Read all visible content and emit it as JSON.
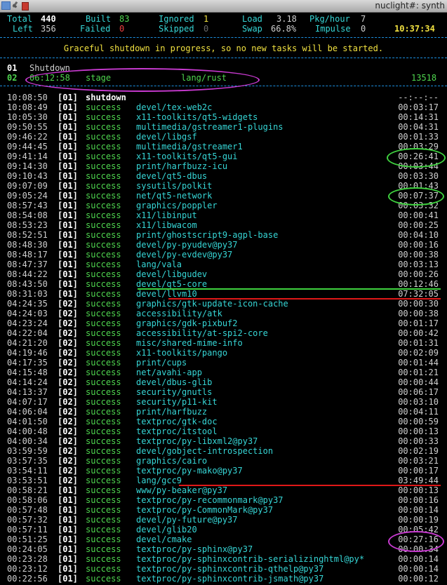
{
  "window": {
    "title": "nuclight#: synth"
  },
  "stats": {
    "row1": [
      {
        "label": "Total",
        "value": "440",
        "color": "white"
      },
      {
        "label": "Built",
        "value": "83",
        "color": "green"
      },
      {
        "label": "Ignored",
        "value": "1",
        "color": "yellow"
      },
      {
        "label": "Load",
        "value": "3.18",
        "color": "grey"
      },
      {
        "label": "Pkg/hour",
        "value": "7",
        "color": "grey"
      }
    ],
    "row2": [
      {
        "label": "Left",
        "value": "356",
        "color": "grey"
      },
      {
        "label": "Failed",
        "value": "0",
        "color": "red"
      },
      {
        "label": "Skipped",
        "value": "0",
        "color": "dimgrey"
      },
      {
        "label": "Swap",
        "value": "66.8%",
        "color": "grey"
      },
      {
        "label": "Impulse",
        "value": "0",
        "color": "grey"
      }
    ],
    "clock": "10:37:34"
  },
  "notice": "Graceful shutdown in progress, so no new tasks will be started.",
  "builders": [
    {
      "id": "01",
      "status": "Shutdown",
      "elapsed": "",
      "phase": "",
      "origin": "",
      "lines": ""
    },
    {
      "id": "02",
      "status": "",
      "elapsed": "06:12:58",
      "phase": "stage",
      "origin": "lang/rust",
      "lines": "13518"
    }
  ],
  "log": [
    {
      "time": "10:08:50",
      "slot": "[01]",
      "result": "shutdown",
      "origin": "",
      "duration": "--:--:--"
    },
    {
      "time": "10:08:49",
      "slot": "[01]",
      "result": "success",
      "origin": "devel/tex-web2c",
      "duration": "00:03:17"
    },
    {
      "time": "10:05:30",
      "slot": "[01]",
      "result": "success",
      "origin": "x11-toolkits/qt5-widgets",
      "duration": "00:14:31"
    },
    {
      "time": "09:50:55",
      "slot": "[01]",
      "result": "success",
      "origin": "multimedia/gstreamer1-plugins",
      "duration": "00:04:31"
    },
    {
      "time": "09:46:22",
      "slot": "[01]",
      "result": "success",
      "origin": "devel/libgsf",
      "duration": "00:01:33"
    },
    {
      "time": "09:44:45",
      "slot": "[01]",
      "result": "success",
      "origin": "multimedia/gstreamer1",
      "duration": "00:03:29"
    },
    {
      "time": "09:41:14",
      "slot": "[01]",
      "result": "success",
      "origin": "x11-toolkits/qt5-gui",
      "duration": "00:26:41"
    },
    {
      "time": "09:14:30",
      "slot": "[01]",
      "result": "success",
      "origin": "print/harfbuzz-icu",
      "duration": "00:03:44"
    },
    {
      "time": "09:10:43",
      "slot": "[01]",
      "result": "success",
      "origin": "devel/qt5-dbus",
      "duration": "00:03:30"
    },
    {
      "time": "09:07:09",
      "slot": "[01]",
      "result": "success",
      "origin": "sysutils/polkit",
      "duration": "00:01:43"
    },
    {
      "time": "09:05:24",
      "slot": "[01]",
      "result": "success",
      "origin": "net/qt5-network",
      "duration": "00:07:37"
    },
    {
      "time": "08:57:43",
      "slot": "[01]",
      "result": "success",
      "origin": "graphics/poppler",
      "duration": "00:03:32"
    },
    {
      "time": "08:54:08",
      "slot": "[01]",
      "result": "success",
      "origin": "x11/libinput",
      "duration": "00:00:41"
    },
    {
      "time": "08:53:23",
      "slot": "[01]",
      "result": "success",
      "origin": "x11/libwacom",
      "duration": "00:00:25"
    },
    {
      "time": "08:52:51",
      "slot": "[01]",
      "result": "success",
      "origin": "print/ghostscript9-agpl-base",
      "duration": "00:04:10"
    },
    {
      "time": "08:48:30",
      "slot": "[01]",
      "result": "success",
      "origin": "devel/py-pyudev@py37",
      "duration": "00:00:16"
    },
    {
      "time": "08:48:17",
      "slot": "[01]",
      "result": "success",
      "origin": "devel/py-evdev@py37",
      "duration": "00:00:38"
    },
    {
      "time": "08:47:37",
      "slot": "[01]",
      "result": "success",
      "origin": "lang/vala",
      "duration": "00:03:13"
    },
    {
      "time": "08:44:22",
      "slot": "[01]",
      "result": "success",
      "origin": "devel/libgudev",
      "duration": "00:00:26"
    },
    {
      "time": "08:43:50",
      "slot": "[01]",
      "result": "success",
      "origin": "devel/qt5-core",
      "duration": "00:12:46"
    },
    {
      "time": "08:31:03",
      "slot": "[01]",
      "result": "success",
      "origin": "devel/llvm10",
      "duration": "07:32:05"
    },
    {
      "time": "04:24:35",
      "slot": "[02]",
      "result": "success",
      "origin": "graphics/gtk-update-icon-cache",
      "duration": "00:00:30"
    },
    {
      "time": "04:24:03",
      "slot": "[02]",
      "result": "success",
      "origin": "accessibility/atk",
      "duration": "00:00:38"
    },
    {
      "time": "04:23:24",
      "slot": "[02]",
      "result": "success",
      "origin": "graphics/gdk-pixbuf2",
      "duration": "00:01:17"
    },
    {
      "time": "04:22:04",
      "slot": "[02]",
      "result": "success",
      "origin": "accessibility/at-spi2-core",
      "duration": "00:00:42"
    },
    {
      "time": "04:21:20",
      "slot": "[02]",
      "result": "success",
      "origin": "misc/shared-mime-info",
      "duration": "00:01:31"
    },
    {
      "time": "04:19:46",
      "slot": "[02]",
      "result": "success",
      "origin": "x11-toolkits/pango",
      "duration": "00:02:09"
    },
    {
      "time": "04:17:35",
      "slot": "[02]",
      "result": "success",
      "origin": "print/cups",
      "duration": "00:01:44"
    },
    {
      "time": "04:15:48",
      "slot": "[02]",
      "result": "success",
      "origin": "net/avahi-app",
      "duration": "00:01:21"
    },
    {
      "time": "04:14:24",
      "slot": "[02]",
      "result": "success",
      "origin": "devel/dbus-glib",
      "duration": "00:00:44"
    },
    {
      "time": "04:13:37",
      "slot": "[02]",
      "result": "success",
      "origin": "security/gnutls",
      "duration": "00:06:17"
    },
    {
      "time": "04:07:17",
      "slot": "[02]",
      "result": "success",
      "origin": "security/p11-kit",
      "duration": "00:03:10"
    },
    {
      "time": "04:06:04",
      "slot": "[02]",
      "result": "success",
      "origin": "print/harfbuzz",
      "duration": "00:04:11"
    },
    {
      "time": "04:01:50",
      "slot": "[02]",
      "result": "success",
      "origin": "textproc/gtk-doc",
      "duration": "00:00:59"
    },
    {
      "time": "04:00:48",
      "slot": "[02]",
      "result": "success",
      "origin": "textproc/itstool",
      "duration": "00:00:13"
    },
    {
      "time": "04:00:34",
      "slot": "[02]",
      "result": "success",
      "origin": "textproc/py-libxml2@py37",
      "duration": "00:00:33"
    },
    {
      "time": "03:59:59",
      "slot": "[02]",
      "result": "success",
      "origin": "devel/gobject-introspection",
      "duration": "00:02:19"
    },
    {
      "time": "03:57:35",
      "slot": "[02]",
      "result": "success",
      "origin": "graphics/cairo",
      "duration": "00:03:21"
    },
    {
      "time": "03:54:11",
      "slot": "[02]",
      "result": "success",
      "origin": "textproc/py-mako@py37",
      "duration": "00:00:17"
    },
    {
      "time": "03:53:51",
      "slot": "[02]",
      "result": "success",
      "origin": "lang/gcc9",
      "duration": "03:49:44"
    },
    {
      "time": "00:58:21",
      "slot": "[01]",
      "result": "success",
      "origin": "www/py-beaker@py37",
      "duration": "00:00:13"
    },
    {
      "time": "00:58:06",
      "slot": "[01]",
      "result": "success",
      "origin": "textproc/py-recommonmark@py37",
      "duration": "00:00:16"
    },
    {
      "time": "00:57:48",
      "slot": "[01]",
      "result": "success",
      "origin": "textproc/py-CommonMark@py37",
      "duration": "00:00:14"
    },
    {
      "time": "00:57:32",
      "slot": "[01]",
      "result": "success",
      "origin": "devel/py-future@py37",
      "duration": "00:00:19"
    },
    {
      "time": "00:57:11",
      "slot": "[01]",
      "result": "success",
      "origin": "devel/glib20",
      "duration": "00:05:42"
    },
    {
      "time": "00:51:25",
      "slot": "[01]",
      "result": "success",
      "origin": "devel/cmake",
      "duration": "00:27:16"
    },
    {
      "time": "00:24:05",
      "slot": "[01]",
      "result": "success",
      "origin": "textproc/py-sphinx@py37",
      "duration": "00:00:34"
    },
    {
      "time": "00:23:28",
      "slot": "[01]",
      "result": "success",
      "origin": "textproc/py-sphinxcontrib-serializinghtml@py*",
      "duration": "00:00:14"
    },
    {
      "time": "00:23:12",
      "slot": "[01]",
      "result": "success",
      "origin": "textproc/py-sphinxcontrib-qthelp@py37",
      "duration": "00:00:14"
    },
    {
      "time": "00:22:56",
      "slot": "[01]",
      "result": "success",
      "origin": "textproc/py-sphinxcontrib-jsmath@py37",
      "duration": "00:00:12"
    }
  ],
  "annotations": {
    "green": "#3fd23f",
    "red": "#e01818",
    "magenta": "#c83ad0"
  }
}
